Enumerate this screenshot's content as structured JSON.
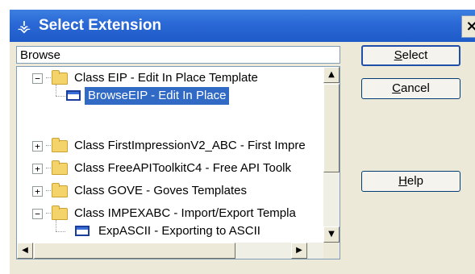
{
  "window": {
    "title": "Select Extension",
    "title_icon": "clarion-icon",
    "close_label": "×"
  },
  "search": {
    "value": "Browse"
  },
  "tree": {
    "items": [
      {
        "label": "Class EIP - Edit In Place Template",
        "type": "folder",
        "expanded": true,
        "level": 0
      },
      {
        "label": "BrowseEIP - Edit In Place",
        "type": "extension",
        "selected": true,
        "level": 1
      },
      {
        "label": "Class FirstImpressionV2_ABC - First Impre",
        "type": "folder",
        "expanded": false,
        "level": 0
      },
      {
        "label": "Class FreeAPIToolkitC4 - Free API Toolk",
        "type": "folder",
        "expanded": false,
        "level": 0
      },
      {
        "label": "Class GOVE - Goves Templates",
        "type": "folder",
        "expanded": false,
        "level": 0
      },
      {
        "label": "Class IMPEXABC - Import/Export Templa",
        "type": "folder",
        "expanded": true,
        "level": 0
      },
      {
        "label": "ExpASCII - Exporting to ASCII",
        "type": "extension",
        "selected": false,
        "level": 1
      }
    ],
    "expanded_symbol": "−",
    "collapsed_symbol": "+"
  },
  "scroll": {
    "up": "▲",
    "down": "▼",
    "left": "◀",
    "right": "▶",
    "vertical_position_percent": 45,
    "horizontal_position_percent": 0
  },
  "buttons": {
    "select_accel": "S",
    "select_rest": "elect",
    "cancel_accel": "C",
    "cancel_rest": "ancel",
    "help_accel": "H",
    "help_rest": "elp"
  }
}
